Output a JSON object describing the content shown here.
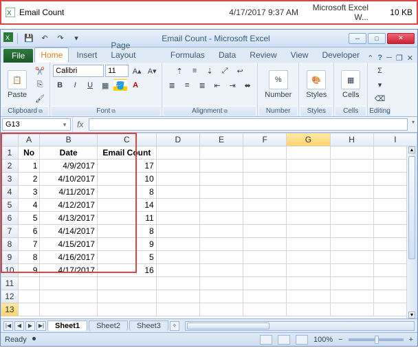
{
  "file_row": {
    "name": "Email Count",
    "date": "4/17/2017 9:37 AM",
    "type": "Microsoft Excel W...",
    "size": "10 KB"
  },
  "titlebar": {
    "title": "Email Count - Microsoft Excel"
  },
  "tabs": {
    "file": "File",
    "home": "Home",
    "insert": "Insert",
    "page_layout": "Page Layout",
    "formulas": "Formulas",
    "data": "Data",
    "review": "Review",
    "view": "View",
    "developer": "Developer"
  },
  "ribbon": {
    "clipboard": {
      "label": "Clipboard",
      "paste": "Paste"
    },
    "font": {
      "label": "Font",
      "name": "Calibri",
      "size": "11"
    },
    "alignment": {
      "label": "Alignment"
    },
    "number": {
      "label": "Number",
      "btn": "Number"
    },
    "styles": {
      "label": "Styles",
      "btn": "Styles"
    },
    "cells": {
      "label": "Cells",
      "btn": "Cells"
    },
    "editing": {
      "label": "Editing"
    }
  },
  "namebox": "G13",
  "fx_label": "fx",
  "columns": [
    "A",
    "B",
    "C",
    "D",
    "E",
    "F",
    "G",
    "H",
    "I"
  ],
  "headers": {
    "A": "No",
    "B": "Date",
    "C": "Email Count"
  },
  "rows": [
    {
      "n": "1",
      "A": "1",
      "B": "4/9/2017",
      "C": "17"
    },
    {
      "n": "2",
      "A": "2",
      "B": "4/10/2017",
      "C": "10"
    },
    {
      "n": "3",
      "A": "3",
      "B": "4/11/2017",
      "C": "8"
    },
    {
      "n": "4",
      "A": "4",
      "B": "4/12/2017",
      "C": "14"
    },
    {
      "n": "5",
      "A": "5",
      "B": "4/13/2017",
      "C": "11"
    },
    {
      "n": "6",
      "A": "6",
      "B": "4/14/2017",
      "C": "8"
    },
    {
      "n": "7",
      "A": "7",
      "B": "4/15/2017",
      "C": "9"
    },
    {
      "n": "8",
      "A": "8",
      "B": "4/16/2017",
      "C": "5"
    },
    {
      "n": "9",
      "A": "9",
      "B": "4/17/2017",
      "C": "16"
    }
  ],
  "row_numbers": [
    "1",
    "2",
    "3",
    "4",
    "5",
    "6",
    "7",
    "8",
    "9",
    "10",
    "11",
    "12",
    "13"
  ],
  "sheets": {
    "s1": "Sheet1",
    "s2": "Sheet2",
    "s3": "Sheet3"
  },
  "status": {
    "ready": "Ready",
    "zoom": "100%"
  }
}
